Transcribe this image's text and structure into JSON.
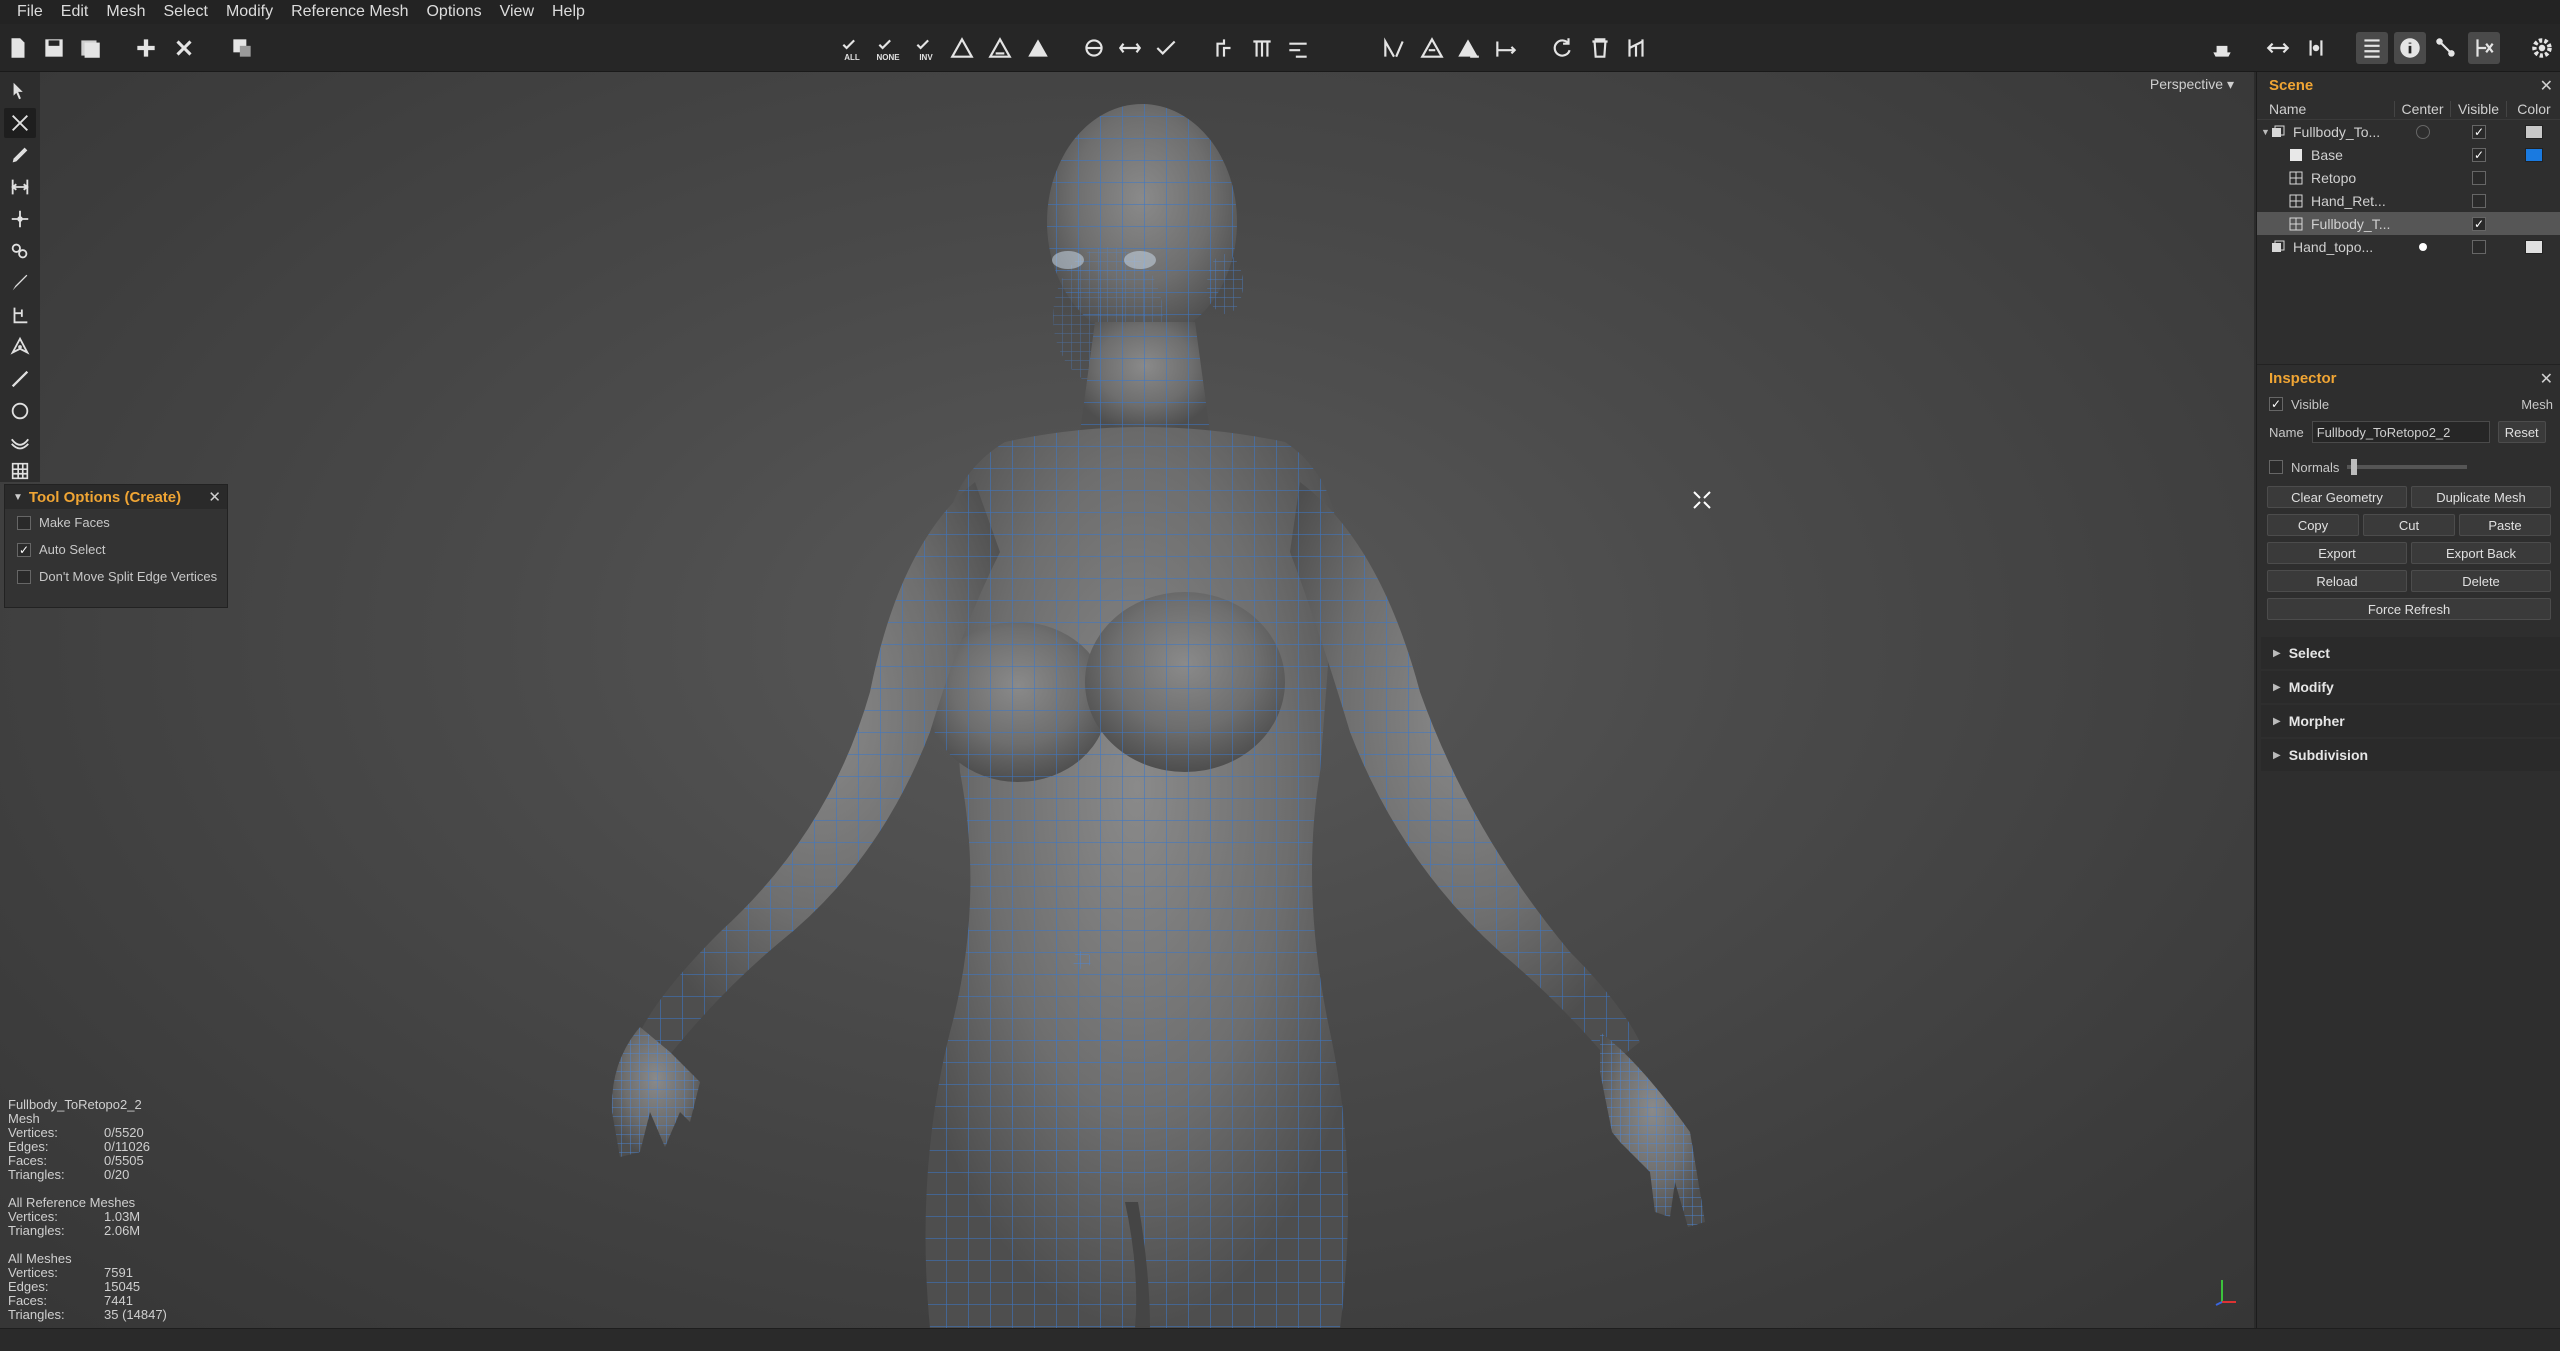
{
  "menu": [
    "File",
    "Edit",
    "Mesh",
    "Select",
    "Modify",
    "Reference Mesh",
    "Options",
    "View",
    "Help"
  ],
  "toolbar": {
    "select_all_label": "ALL",
    "select_none_label": "NONE",
    "select_invert_label": "INV"
  },
  "viewport": {
    "projection": "Perspective",
    "mesh_wire_color": "#3a76c8"
  },
  "tool_options": {
    "title": "Tool Options (Create)",
    "options": [
      {
        "label": "Make Faces",
        "checked": false
      },
      {
        "label": "Auto Select",
        "checked": true
      },
      {
        "label": "Don't Move Split Edge Vertices",
        "checked": false
      }
    ]
  },
  "stats": {
    "mesh_name": "Fullbody_ToRetopo2_2",
    "mesh_type": "Mesh",
    "selection": [
      {
        "k": "Vertices:",
        "v": "0/5520"
      },
      {
        "k": "Edges:",
        "v": "0/11026"
      },
      {
        "k": "Faces:",
        "v": "0/5505"
      },
      {
        "k": "Triangles:",
        "v": "0/20"
      }
    ],
    "reference_title": "All Reference Meshes",
    "reference": [
      {
        "k": "Vertices:",
        "v": "1.03M"
      },
      {
        "k": "Triangles:",
        "v": "2.06M"
      }
    ],
    "all_title": "All Meshes",
    "all": [
      {
        "k": "Vertices:",
        "v": "7591"
      },
      {
        "k": "Edges:",
        "v": "15045"
      },
      {
        "k": "Faces:",
        "v": "7441"
      },
      {
        "k": "Triangles:",
        "v": "35 (14847)"
      }
    ]
  },
  "scene": {
    "title": "Scene",
    "columns": {
      "name": "Name",
      "center": "Center",
      "visible": "Visible",
      "color": "Color"
    },
    "rows": [
      {
        "name": "Fullbody_To...",
        "icon": "object-icon",
        "center": "ring",
        "visible": true,
        "color": "#c8c8c8",
        "indent": 0,
        "expanded": true
      },
      {
        "name": "Base",
        "icon": "reference-icon",
        "center": "",
        "visible": true,
        "color": "#1a7ae0",
        "indent": 1
      },
      {
        "name": "Retopo",
        "icon": "grid-icon",
        "center": "",
        "visible": false,
        "color": "",
        "indent": 1
      },
      {
        "name": "Hand_Ret...",
        "icon": "grid-icon",
        "center": "",
        "visible": false,
        "color": "",
        "indent": 1
      },
      {
        "name": "Fullbody_T...",
        "icon": "grid-icon",
        "center": "",
        "visible": true,
        "color": "",
        "indent": 1,
        "selected": true
      },
      {
        "name": "Hand_topo...",
        "icon": "object-icon",
        "center": "dot",
        "visible": false,
        "color": "#e0e0e0",
        "indent": 0
      }
    ]
  },
  "inspector": {
    "title": "Inspector",
    "visible_label": "Visible",
    "visible_checked": true,
    "type_label": "Mesh",
    "name_label": "Name",
    "name_value": "Fullbody_ToRetopo2_2",
    "reset_label": "Reset",
    "normals_label": "Normals",
    "buttons": {
      "clear_geometry": "Clear Geometry",
      "duplicate_mesh": "Duplicate Mesh",
      "copy": "Copy",
      "cut": "Cut",
      "paste": "Paste",
      "export": "Export",
      "export_back": "Export Back",
      "reload": "Reload",
      "delete": "Delete",
      "force_refresh": "Force Refresh"
    },
    "sections": [
      "Select",
      "Modify",
      "Morpher",
      "Subdivision"
    ]
  }
}
